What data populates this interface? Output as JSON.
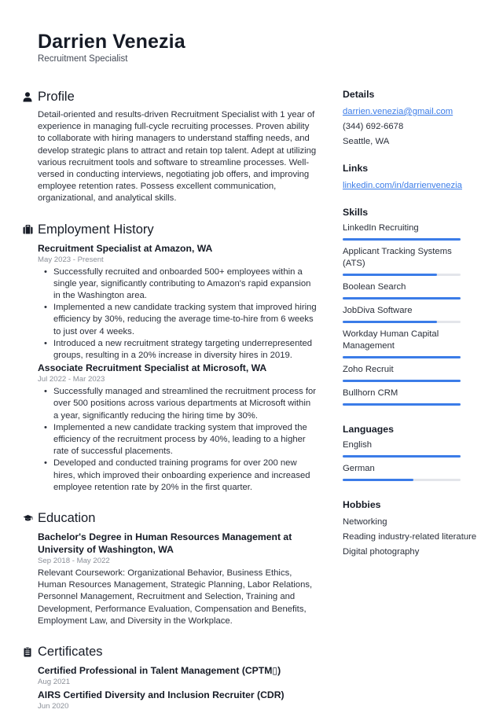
{
  "header": {
    "name": "Darrien Venezia",
    "role": "Recruitment Specialist"
  },
  "profile": {
    "title": "Profile",
    "icon": "person-icon",
    "text": "Detail-oriented and results-driven Recruitment Specialist with 1 year of experience in managing full-cycle recruiting processes. Proven ability to collaborate with hiring managers to understand staffing needs, and develop strategic plans to attract and retain top talent. Adept at utilizing various recruitment tools and software to streamline processes. Well-versed in conducting interviews, negotiating job offers, and improving employee retention rates. Possess excellent communication, organizational, and analytical skills."
  },
  "employment": {
    "title": "Employment History",
    "icon": "briefcase-icon",
    "jobs": [
      {
        "title": "Recruitment Specialist at Amazon, WA",
        "date": "May 2023 - Present",
        "bullets": [
          "Successfully recruited and onboarded 500+ employees within a single year, significantly contributing to Amazon's rapid expansion in the Washington area.",
          "Implemented a new candidate tracking system that improved hiring efficiency by 30%, reducing the average time-to-hire from 6 weeks to just over 4 weeks.",
          "Introduced a new recruitment strategy targeting underrepresented groups, resulting in a 20% increase in diversity hires in 2019."
        ]
      },
      {
        "title": "Associate Recruitment Specialist at Microsoft, WA",
        "date": "Jul 2022 - Mar 2023",
        "bullets": [
          "Successfully managed and streamlined the recruitment process for over 500 positions across various departments at Microsoft within a year, significantly reducing the hiring time by 30%.",
          "Implemented a new candidate tracking system that improved the efficiency of the recruitment process by 40%, leading to a higher rate of successful placements.",
          "Developed and conducted training programs for over 200 new hires, which improved their onboarding experience and increased employee retention rate by 20% in the first quarter."
        ]
      }
    ]
  },
  "education": {
    "title": "Education",
    "icon": "graduation-cap-icon",
    "items": [
      {
        "title": "Bachelor's Degree in Human Resources Management at University of Washington, WA",
        "date": "Sep 2018 - May 2022",
        "text": "Relevant Coursework: Organizational Behavior, Business Ethics, Human Resources Management, Strategic Planning, Labor Relations, Personnel Management, Recruitment and Selection, Training and Development, Performance Evaluation, Compensation and Benefits, Employment Law, and Diversity in the Workplace."
      }
    ]
  },
  "certificates": {
    "title": "Certificates",
    "icon": "clipboard-icon",
    "items": [
      {
        "title": "Certified Professional in Talent Management (CPTM▯)",
        "date": "Aug 2021"
      },
      {
        "title": "AIRS Certified Diversity and Inclusion Recruiter (CDR)",
        "date": "Jun 2020"
      }
    ]
  },
  "sidebar": {
    "details": {
      "title": "Details",
      "email": "darrien.venezia@gmail.com",
      "phone": "(344) 692-6678",
      "location": "Seattle, WA"
    },
    "links": {
      "title": "Links",
      "items": [
        "linkedin.com/in/darrienvenezia"
      ]
    },
    "skills": {
      "title": "Skills",
      "items": [
        {
          "name": "LinkedIn Recruiting",
          "level": 1.0
        },
        {
          "name": "Applicant Tracking Systems (ATS)",
          "level": 0.8
        },
        {
          "name": "Boolean Search",
          "level": 1.0
        },
        {
          "name": "JobDiva Software",
          "level": 0.8
        },
        {
          "name": "Workday Human Capital Management",
          "level": 1.0
        },
        {
          "name": "Zoho Recruit",
          "level": 1.0
        },
        {
          "name": "Bullhorn CRM",
          "level": 1.0
        }
      ]
    },
    "languages": {
      "title": "Languages",
      "items": [
        {
          "name": "English",
          "level": 1.0
        },
        {
          "name": "German",
          "level": 0.6
        }
      ]
    },
    "hobbies": {
      "title": "Hobbies",
      "items": [
        "Networking",
        "Reading industry-related literature",
        "Digital photography"
      ]
    }
  },
  "colors": {
    "accent": "#3b7ce8",
    "bar_track": "#e3e5ea",
    "heading": "#161b26",
    "muted": "#8a8f98"
  }
}
